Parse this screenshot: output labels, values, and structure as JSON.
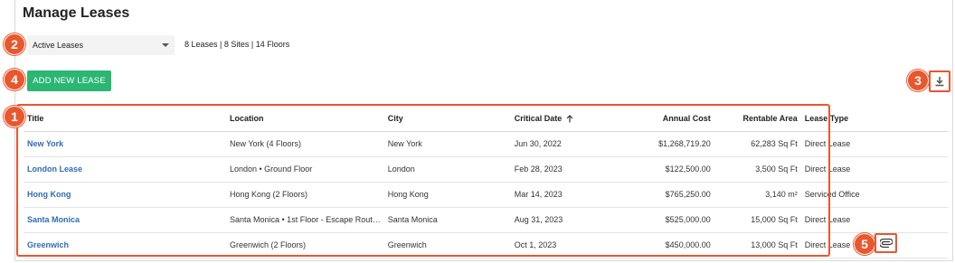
{
  "page": {
    "title": "Manage Leases"
  },
  "filter": {
    "selected": "Active Leases",
    "summary": "8 Leases | 8 Sites | 14 Floors"
  },
  "actions": {
    "add_label": "ADD NEW LEASE"
  },
  "callouts": {
    "table": "1",
    "filter": "2",
    "download": "3",
    "add": "4",
    "attach": "5"
  },
  "colors": {
    "accent": "#e8572e",
    "primary_green": "#2bb673",
    "link_blue": "#2f6db5"
  },
  "icons": {
    "download": "download-icon",
    "attach": "paperclip-icon",
    "sort": "arrow-up-icon",
    "dropdown": "caret-down-icon"
  },
  "table": {
    "columns": [
      "Title",
      "Location",
      "City",
      "Critical Date",
      "Annual Cost",
      "Rentable Area",
      "Lease Type"
    ],
    "rows": [
      [
        "New York",
        "New York (4 Floors)",
        "New York",
        "Jun 30, 2022",
        "$1,268,719.20",
        "62,283 Sq Ft",
        "Direct Lease"
      ],
      [
        "London Lease",
        "London • Ground Floor",
        "London",
        "Feb 28, 2023",
        "$122,500.00",
        "3,500 Sq Ft",
        "Direct Lease"
      ],
      [
        "Hong Kong",
        "Hong Kong (2 Floors)",
        "Hong Kong",
        "Mar 14, 2023",
        "$765,250.00",
        "3,140 m²",
        "Serviced Office"
      ],
      [
        "Santa Monica",
        "Santa Monica • 1st Floor - Escape Rout…",
        "Santa Monica",
        "Aug 31, 2023",
        "$525,000.00",
        "15,000 Sq Ft",
        "Direct Lease"
      ],
      [
        "Greenwich",
        "Greenwich (2 Floors)",
        "Greenwich",
        "Oct 1, 2023",
        "$450,000.00",
        "13,000 Sq Ft",
        "Direct Lease"
      ]
    ]
  }
}
